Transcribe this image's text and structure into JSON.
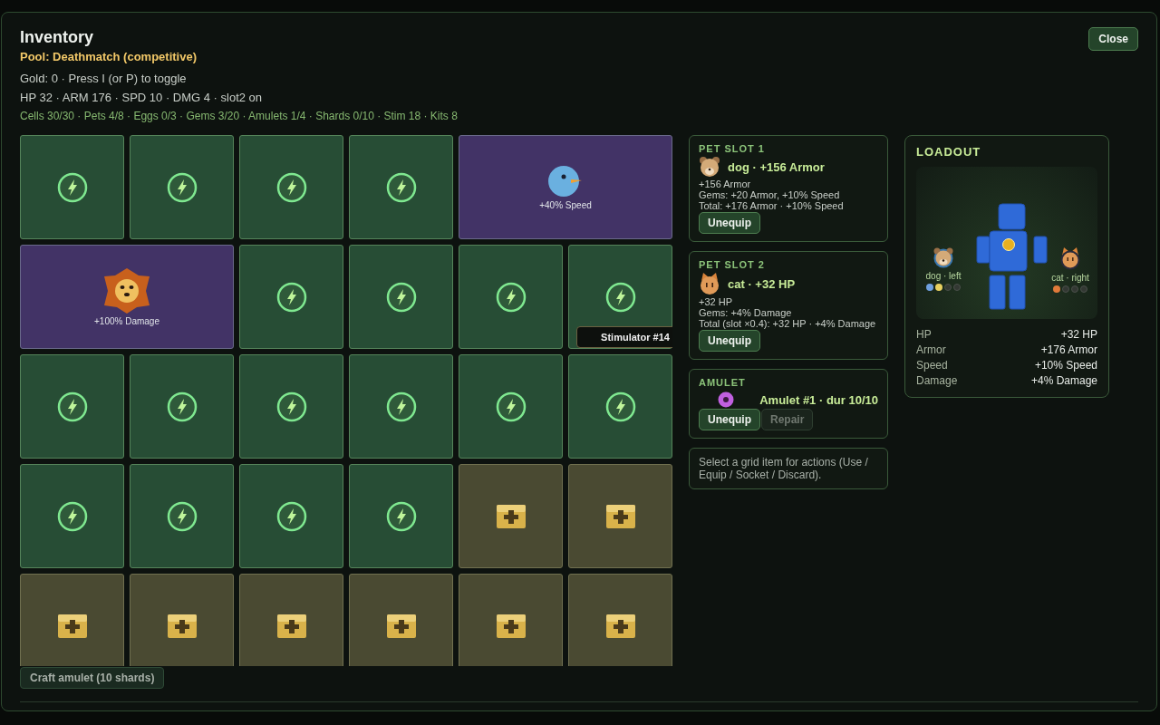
{
  "window": {
    "title": "Inventory"
  },
  "pool": "Pool: Deathmatch (competitive)",
  "info_lines": [
    "Gold: 0 · Press I (or P) to toggle",
    "HP 32 · ARM 176 · SPD 10 · DMG 4 · slot2 on"
  ],
  "counts": "Cells 30/30 · Pets 4/8 · Eggs 0/3 · Gems 3/20 · Amulets 1/4 · Shards 0/10 · Stim 18 · Kits 8",
  "close_button": "Close",
  "grid": [
    {
      "kind": "stim"
    },
    {
      "kind": "stim"
    },
    {
      "kind": "stim"
    },
    {
      "kind": "stim"
    },
    {
      "kind": "bird",
      "label": "+40% Speed"
    },
    {
      "kind": "lion",
      "label": "+100% Damage"
    },
    {
      "kind": "stim"
    },
    {
      "kind": "stim"
    },
    {
      "kind": "stim"
    },
    {
      "kind": "stim"
    },
    {
      "kind": "stim"
    },
    {
      "kind": "stim"
    },
    {
      "kind": "stim"
    },
    {
      "kind": "stim"
    },
    {
      "kind": "stim"
    },
    {
      "kind": "stim"
    },
    {
      "kind": "stim"
    },
    {
      "kind": "stim"
    },
    {
      "kind": "stim"
    },
    {
      "kind": "stim"
    },
    {
      "kind": "kit"
    },
    {
      "kind": "kit"
    },
    {
      "kind": "kit"
    },
    {
      "kind": "kit"
    },
    {
      "kind": "kit"
    },
    {
      "kind": "kit"
    },
    {
      "kind": "kit"
    },
    {
      "kind": "kit"
    }
  ],
  "tooltip": "Stimulator #14",
  "craft_button": "Craft amulet (10 shards)",
  "pet_slots": [
    {
      "heading": "PET SLOT 1",
      "kind": "dog",
      "name": "dog · +156 Armor",
      "lines": [
        "+156 Armor",
        "Gems: +20 Armor, +10% Speed",
        "Total: +176 Armor · +10% Speed"
      ],
      "button": "Unequip"
    },
    {
      "heading": "PET SLOT 2",
      "kind": "cat",
      "name": "cat · +32 HP",
      "lines": [
        "+32 HP",
        "Gems: +4% Damage",
        "Total (slot ×0.4): +32 HP · +4% Damage"
      ],
      "button": "Unequip"
    }
  ],
  "amulet": {
    "heading": "AMULET",
    "name": "Amulet #1 · dur 10/10",
    "buttons": [
      {
        "label": "Unequip",
        "disabled": false
      },
      {
        "label": "Repair",
        "disabled": true
      }
    ]
  },
  "hint": "Select a grid item for actions (Use / Equip / Socket / Discard).",
  "loadout": {
    "heading": "LOADOUT",
    "left": {
      "kind": "dog",
      "label": "dog · left",
      "gems": [
        {
          "filled": true,
          "color": "#6fa0e0"
        },
        {
          "filled": true,
          "color": "#e8d060"
        },
        {
          "filled": false
        },
        {
          "filled": false
        }
      ]
    },
    "right": {
      "kind": "cat",
      "label": "cat · right",
      "gems": [
        {
          "filled": true,
          "color": "#e07a3a"
        },
        {
          "filled": false
        },
        {
          "filled": false
        },
        {
          "filled": false
        }
      ]
    },
    "stats": [
      {
        "label": "HP",
        "value": "+32 HP"
      },
      {
        "label": "Armor",
        "value": "+176 Armor"
      },
      {
        "label": "Speed",
        "value": "+10% Speed"
      },
      {
        "label": "Damage",
        "value": "+4% Damage"
      }
    ]
  }
}
